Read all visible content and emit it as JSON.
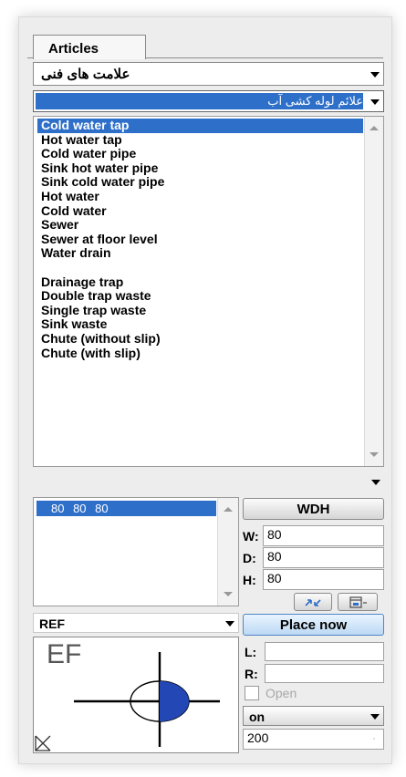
{
  "tab": {
    "label": "Articles"
  },
  "category": {
    "value": "علامت های فنی"
  },
  "subcategory": {
    "value": "علائم لوله کشی آب"
  },
  "articles": [
    {
      "label": "Cold water tap",
      "selected": true
    },
    {
      "label": "Hot water tap"
    },
    {
      "label": "Cold water pipe"
    },
    {
      "label": "Sink hot water pipe"
    },
    {
      "label": "Sink cold water pipe"
    },
    {
      "label": "Hot water"
    },
    {
      "label": "Cold water"
    },
    {
      "label": "Sewer"
    },
    {
      "label": "Sewer at floor level"
    },
    {
      "label": "Water drain"
    },
    {
      "label": ""
    },
    {
      "label": "Drainage trap"
    },
    {
      "label": "Double trap waste"
    },
    {
      "label": "Single trap waste"
    },
    {
      "label": "Sink waste"
    },
    {
      "label": "Chute (without slip)"
    },
    {
      "label": "Chute (with slip)"
    }
  ],
  "sizes": {
    "selected": "80 80 80"
  },
  "dimensions": {
    "button": "WDH",
    "w_label": "W:",
    "w_value": "80",
    "d_label": "D:",
    "d_value": "80",
    "h_label": "H:",
    "h_value": "80"
  },
  "ref": {
    "value": "REF"
  },
  "place_button": "Place now",
  "placement": {
    "l_label": "L:",
    "l_value": "",
    "r_label": "R:",
    "r_value": "",
    "open_label": "Open",
    "mode_value": "on",
    "number_value": "200"
  },
  "preview": {
    "ref_text": "EF"
  },
  "colors": {
    "selection": "#2e6fc9",
    "symbol_fill": "#2447b6"
  }
}
